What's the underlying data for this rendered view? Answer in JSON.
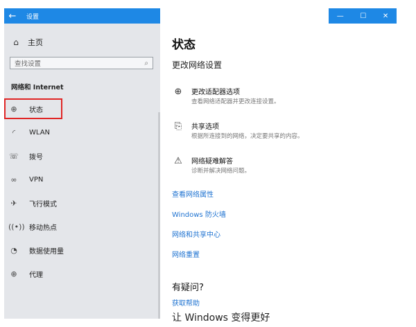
{
  "window": {
    "title": "设置",
    "back_icon": "back-arrow-icon",
    "controls": {
      "minimize": "—",
      "maximize": "☐",
      "close": "✕"
    }
  },
  "sidebar": {
    "home_label": "主页",
    "search_placeholder": "查找设置",
    "section_title": "网络和 Internet",
    "items": [
      {
        "label": "状态",
        "icon": "globe-icon",
        "selected": true
      },
      {
        "label": "WLAN",
        "icon": "wifi-icon",
        "selected": false
      },
      {
        "label": "拨号",
        "icon": "dialup-icon",
        "selected": false
      },
      {
        "label": "VPN",
        "icon": "vpn-icon",
        "selected": false
      },
      {
        "label": "飞行模式",
        "icon": "airplane-icon",
        "selected": false
      },
      {
        "label": "移动热点",
        "icon": "hotspot-icon",
        "selected": false
      },
      {
        "label": "数据使用量",
        "icon": "data-usage-icon",
        "selected": false
      },
      {
        "label": "代理",
        "icon": "globe-icon",
        "selected": false
      }
    ]
  },
  "main": {
    "title": "状态",
    "subtitle": "更改网络设置",
    "options": [
      {
        "title": "更改适配器选项",
        "desc": "查看网络适配器并更改连接设置。"
      },
      {
        "title": "共享选项",
        "desc": "根据所连接到的网络，决定要共享的内容。"
      },
      {
        "title": "网络疑难解答",
        "desc": "诊断并解决网络问题。"
      }
    ],
    "links": [
      "查看网络属性",
      "Windows 防火墙",
      "网络和共享中心",
      "网络重置"
    ],
    "question_title": "有疑问?",
    "help_link": "获取帮助",
    "bottom_title": "让 Windows 变得更好"
  },
  "colors": {
    "accent": "#1e88e5",
    "link": "#1f73d1",
    "highlight": "#e02525"
  }
}
